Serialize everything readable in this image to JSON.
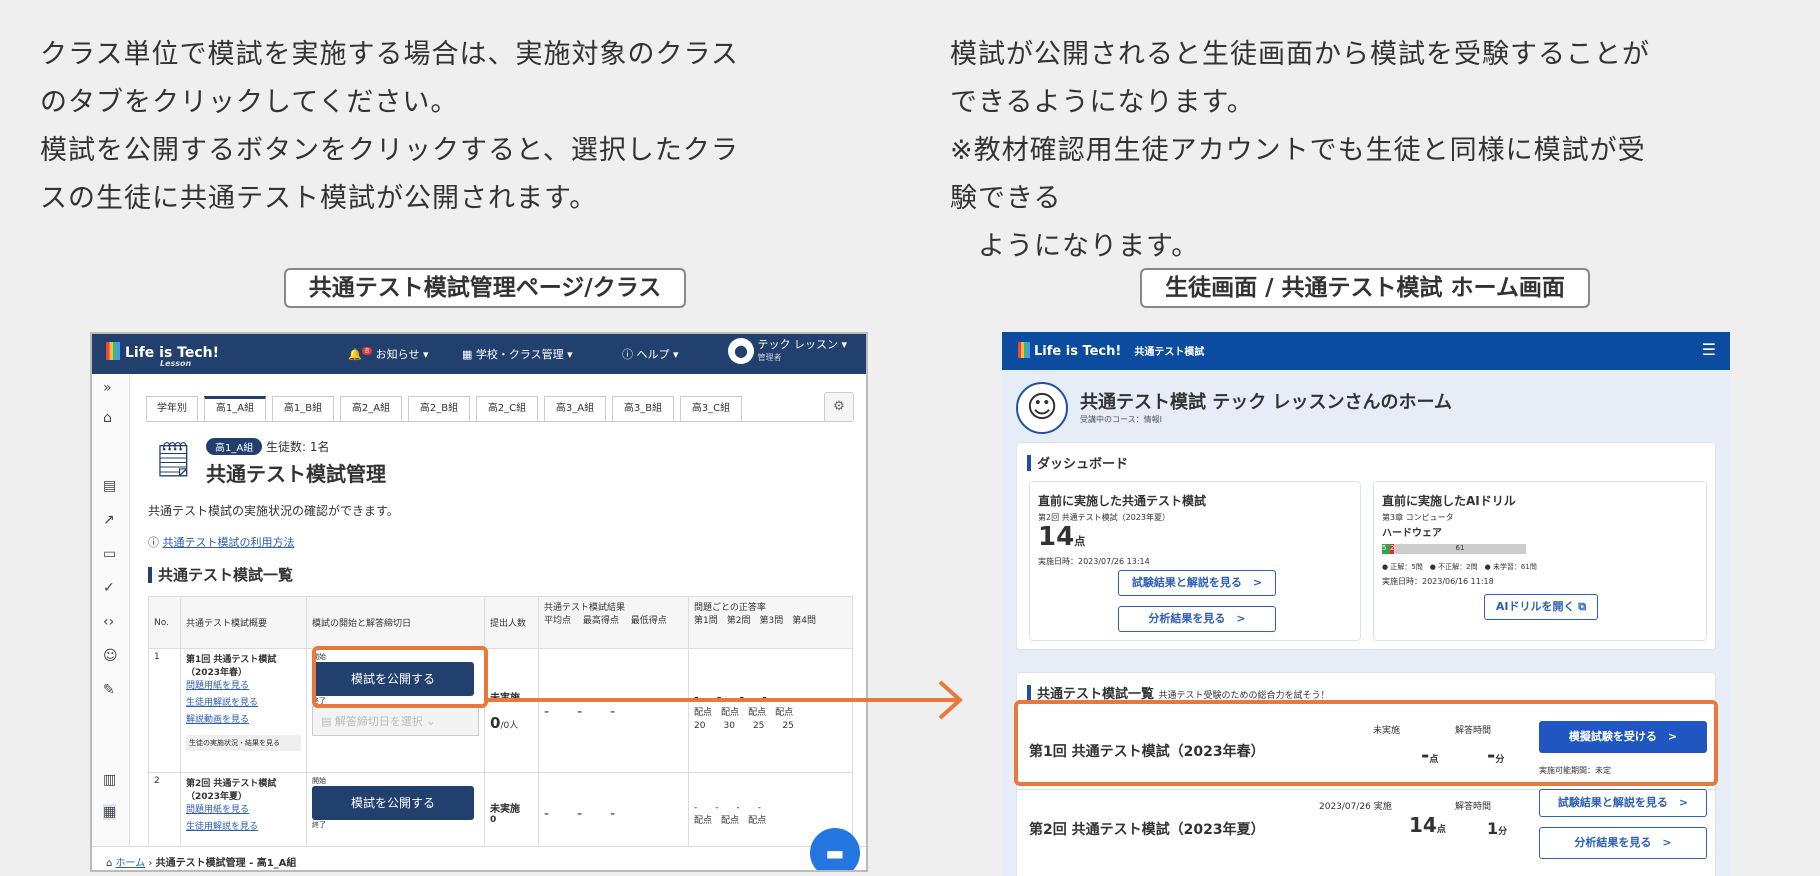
{
  "intro_left": [
    "クラス単位で模試を実施する場合は、実施対象のクラス",
    "のタブをクリックしてください。",
    "模試を公開するボタンをクリックすると、選択したクラ",
    "スの生徒に共通テスト模試が公開されます。"
  ],
  "intro_right": [
    "模試が公開されると生徒画面から模試を受験することが",
    "できるようになります。",
    "※教材確認用生徒アカウントでも生徒と同様に模試が受",
    "験できる",
    "　ようになります。"
  ],
  "caption_left": "共通テスト模試管理ページ/クラス",
  "caption_right": "生徒画面 / 共通テスト模試 ホーム画面",
  "admin": {
    "logo": "Life is Tech!",
    "logo_sub": "Lesson",
    "nav": {
      "notice": "お知らせ ▾",
      "notice_badge": "8",
      "school": "学校・クラス管理 ▾",
      "help": "ヘルプ ▾",
      "user": "テック レッスン ▾",
      "user_role": "管理者"
    },
    "tabs": [
      "学年別",
      "高1_A組",
      "高1_B組",
      "高2_A組",
      "高2_B組",
      "高2_C組",
      "高3_A組",
      "高3_B組",
      "高3_C組"
    ],
    "class_badge": "高1_A組",
    "student_count": "生徒数: 1名",
    "title": "共通テスト模試管理",
    "desc": "共通テスト模試の実施状況の確認ができます。",
    "howto": "共通テスト模試の利用方法",
    "list_title": "共通テスト模試一覧",
    "head": {
      "no": "No.",
      "summary": "共通テスト模試概要",
      "period": "模試の開始と解答締切日",
      "count": "提出人数",
      "result": "共通テスト模試結果",
      "avg": "平均点",
      "max": "最高得点",
      "min": "最低得点",
      "rate": "問題ごとの正答率",
      "q1": "第1問",
      "q2": "第2問",
      "q3": "第3問",
      "q4": "第4問"
    },
    "rows": [
      {
        "no": "1",
        "name": "第1回 共通テスト模試",
        "season": "（2023年春）",
        "l1": "問題用紙を見る",
        "l2": "生徒用解説を見る",
        "l3": "解説動画を見る",
        "status_btn": "生徒の実施状況・結果を見る",
        "start": "開始",
        "publish": "模試を公開する",
        "end": "終了",
        "deadline": "解答締切日を選択",
        "count_status": "未実施",
        "count": "0",
        "count_unit": "/0人",
        "avg": "-",
        "max": "-",
        "min": "-",
        "q": [
          "-",
          "-",
          "-",
          "-"
        ],
        "pts_label": "配点",
        "pts": [
          "20",
          "30",
          "25",
          "25"
        ]
      },
      {
        "no": "2",
        "name": "第2回 共通テスト模試",
        "season": "（2023年夏）",
        "l1": "問題用紙を見る",
        "l2": "生徒用解説を見る",
        "start": "開始",
        "publish": "模試を公開する",
        "end": "終了",
        "count_status": "未実施",
        "count": "0",
        "avg": "-",
        "max": "-",
        "min": "-",
        "q": [
          "-",
          "-",
          "-",
          "-"
        ],
        "pts_label": "配点"
      }
    ],
    "breadcrumb_home": "ホーム",
    "breadcrumb_current": "共通テスト模試管理 - 高1_A組"
  },
  "student": {
    "logo": "Life is Tech!",
    "app": "共通テスト模試",
    "home_title": "共通テスト模試 テック レッスンさんのホーム",
    "course": "受講中のコース：情報I",
    "dashboard": "ダッシュボード",
    "recent_title": "直前に実施した共通テスト模試",
    "recent_sub": "第2回 共通テスト模試（2023年夏）",
    "recent_score": "14",
    "score_unit": "点",
    "recent_date": "実施日時：2023/07/26 13:14",
    "btn_results": "試験結果と解説を見る　>",
    "btn_analysis": "分析結果を見る　>",
    "ai_title": "直前に実施したAIドリル",
    "ai_sub": "第3章 コンピュータ",
    "ai_topic": "ハードウェア",
    "ai_bar": {
      "correct": "5",
      "wrong": "2",
      "unlearned": "61"
    },
    "ai_legend": "● 正解：5問　● 不正解：2問　● 未学習：61問",
    "ai_date": "実施日時：2023/06/16 11:18",
    "btn_ai": "AIドリルを開く ⧉",
    "list_title": "共通テスト模試一覧",
    "list_sub": "共通テスト受験のための総合力を試そう！",
    "exams": [
      {
        "name": "第1回 共通テスト模試（2023年春）",
        "status": "未実施",
        "time_label": "解答時間",
        "score": "-",
        "score_unit": "点",
        "time": "-",
        "time_unit": "分",
        "btn": "模擬試験を受ける　>",
        "period": "実施可能期間：未定"
      },
      {
        "name": "第2回 共通テスト模試（2023年夏）",
        "status": "2023/07/26 実施",
        "time_label": "解答時間",
        "score": "14",
        "score_unit": "点",
        "time": "1",
        "time_unit": "分",
        "btn1": "試験結果と解説を見る　>",
        "btn2": "分析結果を見る　>"
      }
    ]
  },
  "colors": {
    "accent_orange": "#e8793a",
    "admin_navy": "#22406e",
    "student_blue": "#0b4ba0"
  }
}
